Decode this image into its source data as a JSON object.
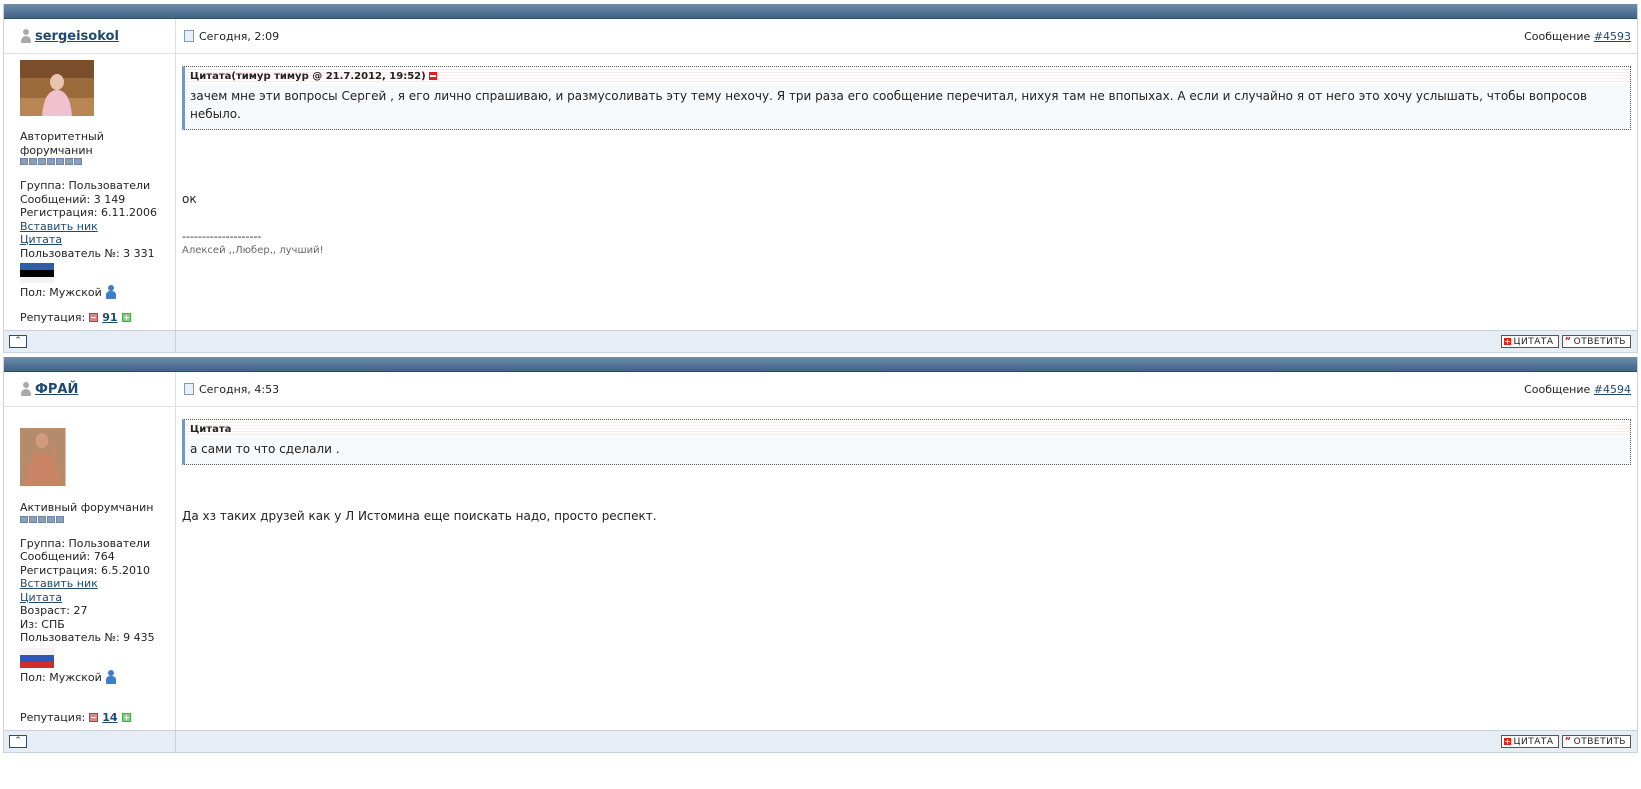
{
  "posts": [
    {
      "author": "sergeisokol",
      "date": "Сегодня, 2:09",
      "msg_label": "Сообщение",
      "msg_no": "#4593",
      "rank": "Авторитетный форумчанин",
      "rank_level": 7,
      "group": "Группа: Пользователи",
      "messages": "Сообщений: 3 149",
      "registered": "Регистрация: 6.11.2006",
      "insert_nick": "Вставить ник",
      "quote_link": "Цитата",
      "user_no": "Пользователь №: 3 331",
      "gender": "Пол: Мужской",
      "reputation_label": "Репутация:",
      "reputation": "91",
      "quote_head": "Цитата(тимур тимур @ 21.7.2012, 19:52)",
      "quote_text": "зачем мне эти вопросы Сергей , я его лично спрашиваю, и размусоливать эту тему нехочу. Я три раза его сообщение перечитал, нихуя там не впопыхах. А если и случайно я от него это хочу услышать, чтобы вопросов небыло.",
      "text": "ок",
      "sig_line": "--------------------",
      "signature": "Алексей ,,Любер,, лучший!",
      "btn_quote": "ЦИТАТА",
      "btn_reply": "ОТВЕТИТЬ"
    },
    {
      "author": "ФРАЙ",
      "date": "Сегодня, 4:53",
      "msg_label": "Сообщение",
      "msg_no": "#4594",
      "rank": "Активный форумчанин",
      "rank_level": 5,
      "group": "Группа: Пользователи",
      "messages": "Сообщений: 764",
      "registered": "Регистрация: 6.5.2010",
      "insert_nick": "Вставить ник",
      "quote_link": "Цитата",
      "age": "Возраст: 27",
      "from": "Из: СПБ",
      "user_no": "Пользователь №: 9 435",
      "gender": "Пол: Мужской",
      "reputation_label": "Репутация:",
      "reputation": "14",
      "quote_head": "Цитата",
      "quote_text": "а сами то что сделали .",
      "text": "Да хз таких друзей как у Л Истомина еще поискать надо, просто респект.",
      "btn_quote": "ЦИТАТА",
      "btn_reply": "ОТВЕТИТЬ"
    }
  ]
}
